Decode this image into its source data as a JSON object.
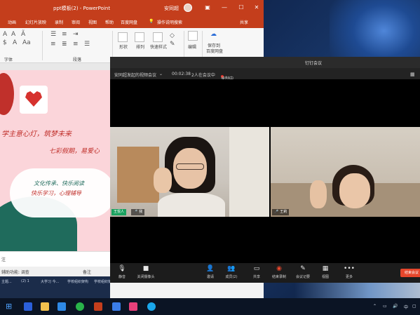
{
  "ppt": {
    "title": "ppt模板(2) - PowerPoint",
    "user": "安同超",
    "tabs": [
      "动画",
      "幻灯片放映",
      "录制",
      "审阅",
      "视图",
      "帮助",
      "百度网盘",
      "操作说明搜索",
      "共享"
    ],
    "ribbon": {
      "group_font": "字体",
      "group_paragraph": "段落",
      "shape": "形状",
      "arrange": "排列",
      "quick_style": "快速样式",
      "edit": "编辑",
      "save_to": "保存到",
      "baidu": "百度网盘"
    },
    "slide": {
      "line1": "学主意心灯，筑梦未来",
      "line2": "七彩假期，易爱心",
      "line3": "文化传承、快乐阅读",
      "line4": "快乐学习，心理辅导"
    },
    "notes_label": "注",
    "status_left": "辅助功能: 调查",
    "status_note": "备注",
    "status_bottom": [
      "主题...",
      "(2) 1",
      "大学习 今...",
      "学校组织架构",
      "学校组织架构"
    ]
  },
  "meeting": {
    "title": "钉钉会议",
    "name": "安同超发起的视频会议",
    "timer": "00:02:38",
    "participants": "2人在会议中",
    "recording": "录制中",
    "tile_left_name": "王悦人",
    "tile_left_name2": "我",
    "tile_right_name": "王莉",
    "tools": [
      {
        "icon": "mic-icon",
        "label": "静音"
      },
      {
        "icon": "camera-icon",
        "label": "关闭摄像头"
      },
      {
        "icon": "invite-icon",
        "label": "邀请"
      },
      {
        "icon": "members-icon",
        "label": "成员(2)"
      },
      {
        "icon": "share-icon",
        "label": "共享"
      },
      {
        "icon": "record-icon",
        "label": "结束录制"
      },
      {
        "icon": "minutes-icon",
        "label": "会议记要"
      },
      {
        "icon": "view-icon",
        "label": "视图"
      },
      {
        "icon": "more-icon",
        "label": "更多"
      }
    ],
    "end_label": "结束会议"
  },
  "colors": {
    "ppt_accent": "#c43e1c",
    "meeting_bg": "#1c1c1c",
    "end_button": "#e5462c"
  }
}
